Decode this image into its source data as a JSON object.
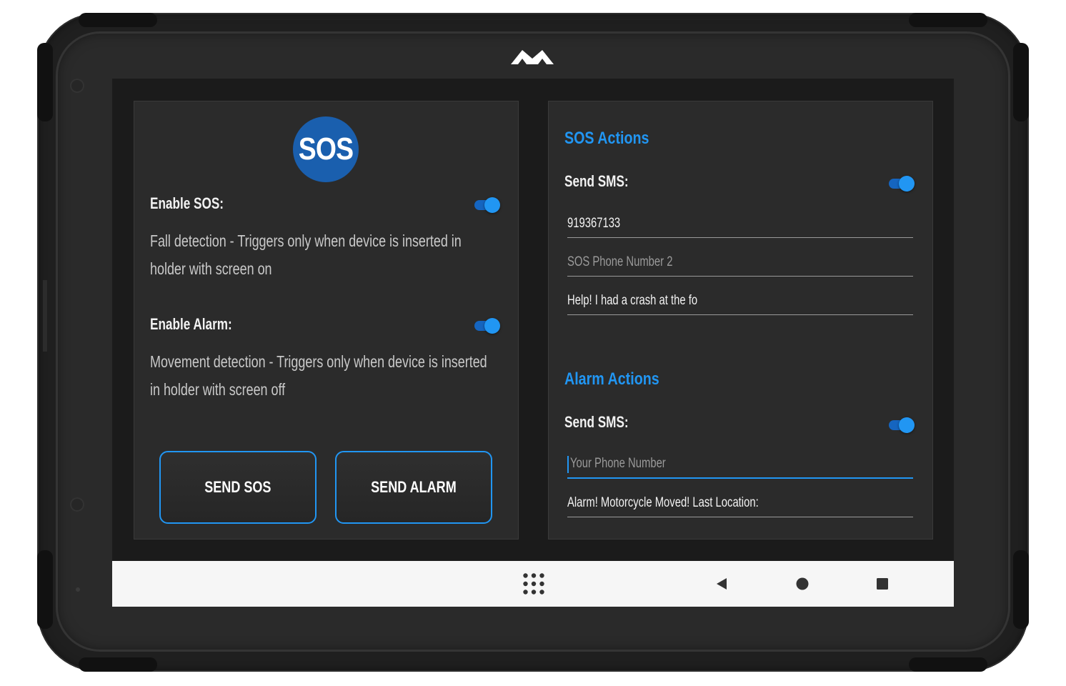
{
  "colors": {
    "accent": "#2196f3",
    "toggle_track": "#1565c0",
    "panel_bg": "#2b2b2b",
    "screen_bg": "#1b1b1b",
    "sos_logo_bg": "#1a5fae",
    "nav_bar_bg": "#f6f6f6"
  },
  "device": {
    "brand_logo_icon": "brand-m-logo-icon"
  },
  "left_panel": {
    "logo_text": "SOS",
    "enable_sos": {
      "label": "Enable SOS:",
      "enabled": true,
      "description": "Fall detection - Triggers only when device is inserted in holder with screen on"
    },
    "enable_alarm": {
      "label": "Enable Alarm:",
      "enabled": true,
      "description": "Movement detection - Triggers only when device is inserted in holder with screen off"
    },
    "send_sos_label": "SEND SOS",
    "send_alarm_label": "SEND ALARM"
  },
  "right_panel": {
    "sos_actions": {
      "title": "SOS Actions",
      "send_sms_label": "Send SMS:",
      "send_sms_enabled": true,
      "phone_1_value": "919367133",
      "phone_2_placeholder": "SOS Phone Number 2",
      "message_value": "Help! I had a crash at the fo"
    },
    "alarm_actions": {
      "title": "Alarm Actions",
      "send_sms_label": "Send SMS:",
      "send_sms_enabled": true,
      "phone_placeholder": "Your Phone Number",
      "message_value": "Alarm! Motorcycle Moved! Last Location:"
    }
  },
  "nav_bar": {
    "icons": [
      "app-grid-icon",
      "back-icon",
      "home-icon",
      "recents-icon"
    ]
  }
}
